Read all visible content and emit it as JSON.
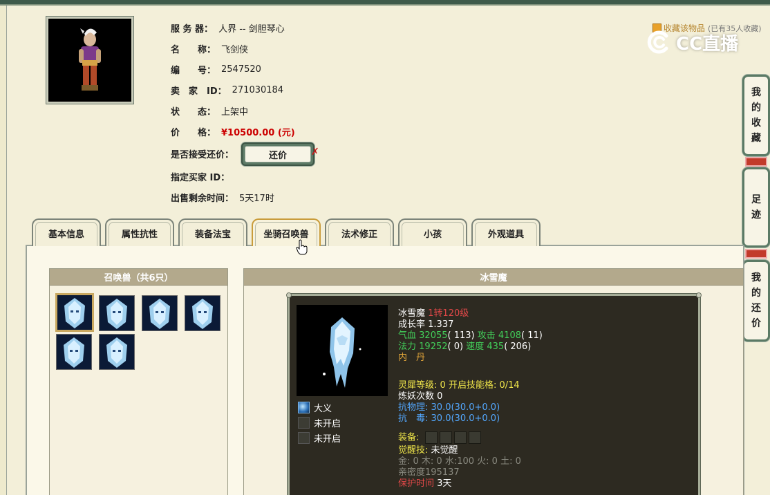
{
  "item": {
    "server_label": "服 务 器：",
    "server": "人界 -- 剑胆琴心",
    "name_label": "名　　称：",
    "name": "飞剑侠",
    "id_label": "编　　号：",
    "id": "2547520",
    "seller_label": "卖　家　ID：",
    "seller_id": "271030184",
    "status_label": "状　　态：",
    "status": "上架中",
    "price_label": "价　　格：",
    "price": "¥10500.00 (元)",
    "bargain_label": "是否接受还价：",
    "bargain_button": "还价",
    "bargain_mark": "✗",
    "buyer_label": "指定买家 ID：",
    "buyer_id": "",
    "remaining_label": "出售剩余时间：",
    "remaining": "5天17时"
  },
  "favorite": {
    "label": "收藏该物品",
    "count": "(已有35人收藏)"
  },
  "watermark": {
    "text": "CC直播"
  },
  "side_buttons": {
    "favorites": [
      "我",
      "的",
      "收",
      "藏"
    ],
    "footprints": [
      "足",
      "迹"
    ],
    "my_bargains": [
      "我",
      "的",
      "还",
      "价"
    ]
  },
  "tabs": [
    "基本信息",
    "属性抗性",
    "装备法宝",
    "坐骑召唤兽",
    "法术修正",
    "小孩",
    "外观道具"
  ],
  "active_tab": "坐骑召唤兽",
  "pets_panel": {
    "title": "召唤兽（共6只）",
    "count": 6,
    "selected_index": 0
  },
  "pet_detail": {
    "title": "冰雪魔",
    "name": "冰雪魔",
    "level": "1转120级",
    "growth_label": "成长率",
    "growth": "1.337",
    "hp_label": "气血",
    "hp": "32055",
    "hp_pts": "( 113)",
    "atk_label": "攻击",
    "atk": "4108",
    "atk_pts": "( 11)",
    "mp_label": "法力",
    "mp": "19252",
    "mp_pts": "( 0)",
    "spd_label": "速度",
    "spd": "435",
    "spd_pts": "( 206)",
    "neidan_label": "内　丹",
    "lingxi_label": "灵犀等级:",
    "lingxi": "0",
    "skillslot_label": "开启技能格:",
    "skillslot": "0/14",
    "lianyao_label": "炼妖次数",
    "lianyao": "0",
    "resist_phys_label": "抗物理:",
    "resist_phys": "30.0",
    "resist_phys_detail": "(30.0+0.0)",
    "resist_poison_label": "抗　毒:",
    "resist_poison": "30.0",
    "resist_poison_detail": "(30.0+0.0)",
    "equip_label": "装备:",
    "awaken_label": "觉醒技:",
    "awaken": "未觉醒",
    "elements": "金: 0 木: 0 水:100 火: 0 土: 0",
    "intimacy_label": "亲密度",
    "intimacy": "195137",
    "protect_label": "保护时间",
    "protect": "3天",
    "skills": [
      "大义",
      "未开启",
      "未开启"
    ]
  },
  "colors": {
    "tab_active_border": "#c99c3b",
    "price": "#cc0000",
    "detail_bg": "#2d2a21",
    "green_stat": "#42cf5a",
    "blue_stat": "#53a8ff",
    "yellow_stat": "#f0e64a"
  }
}
